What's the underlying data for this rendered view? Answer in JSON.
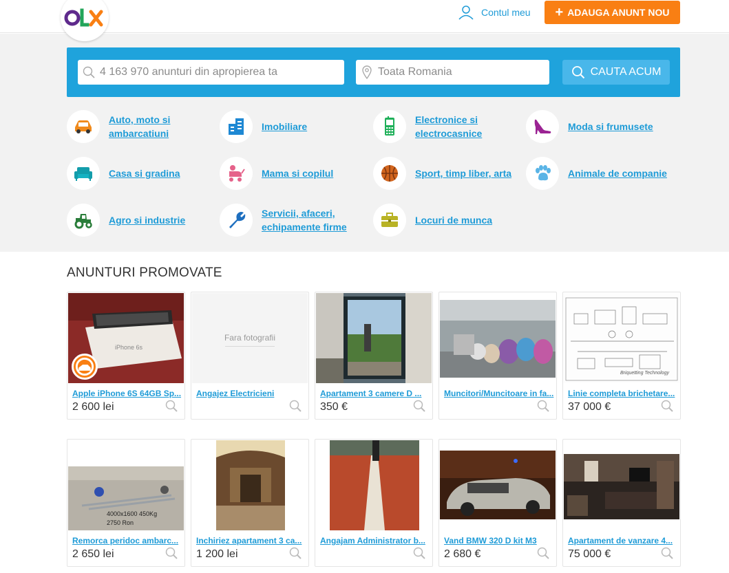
{
  "header": {
    "logo_text": "OLX",
    "account_label": "Contul meu",
    "add_button_label": "ADAUGA ANUNT NOU"
  },
  "search": {
    "query_placeholder": "4 163 970 anunturi din apropierea ta",
    "location_placeholder": "Toata Romania",
    "button_label": "CAUTA ACUM"
  },
  "categories": [
    {
      "label": "Auto, moto si ambarcatiuni",
      "icon": "car-icon"
    },
    {
      "label": "Imobiliare",
      "icon": "buildings-icon"
    },
    {
      "label": "Electronice si electrocasnice",
      "icon": "phone-icon"
    },
    {
      "label": "Moda si frumusete",
      "icon": "high-heel-icon"
    },
    {
      "label": "Casa si gradina",
      "icon": "sofa-icon"
    },
    {
      "label": "Mama si copilul",
      "icon": "stroller-icon"
    },
    {
      "label": "Sport, timp liber, arta",
      "icon": "basketball-icon"
    },
    {
      "label": "Animale de companie",
      "icon": "paw-icon"
    },
    {
      "label": "Agro si industrie",
      "icon": "tractor-icon"
    },
    {
      "label": "Servicii, afaceri, echipamente firme",
      "icon": "wrench-icon"
    },
    {
      "label": "Locuri de munca",
      "icon": "briefcase-icon"
    }
  ],
  "promoted": {
    "title": "ANUNTURI PROMOVATE",
    "no_photo_text": "Fara fotografii",
    "listings": [
      {
        "title": "Apple iPhone 6S 64GB Sp...",
        "price": "2 600 lei"
      },
      {
        "title": "Angajez Electricieni",
        "price": ""
      },
      {
        "title": "Apartament 3 camere D ...",
        "price": "350 €"
      },
      {
        "title": "Muncitori/Muncitoare in fa...",
        "price": ""
      },
      {
        "title": "Linie completa brichetare...",
        "price": "37 000 €"
      },
      {
        "title": "Remorca peridoc ambarc...",
        "price": "2 650 lei"
      },
      {
        "title": "Inchiriez apartament 3 ca...",
        "price": "1 200 lei"
      },
      {
        "title": "Angajam Administrator b...",
        "price": ""
      },
      {
        "title": "Vand BMW 320 D kit M3",
        "price": "2 680 €"
      },
      {
        "title": "Apartament de vanzare 4...",
        "price": "75 000 €"
      }
    ]
  },
  "photo_captions": {
    "iphone_box": "iPhone 6s",
    "trailer_dims": "4000x1600   450Kg",
    "trailer_price": "2750 Ron",
    "briquetting": "Briquetting Technology"
  },
  "colors": {
    "accent_blue": "#1e9bd7",
    "search_bar": "#1fa3dc",
    "cta_orange": "#f97f13",
    "hero_bg": "#f2f2f2"
  }
}
